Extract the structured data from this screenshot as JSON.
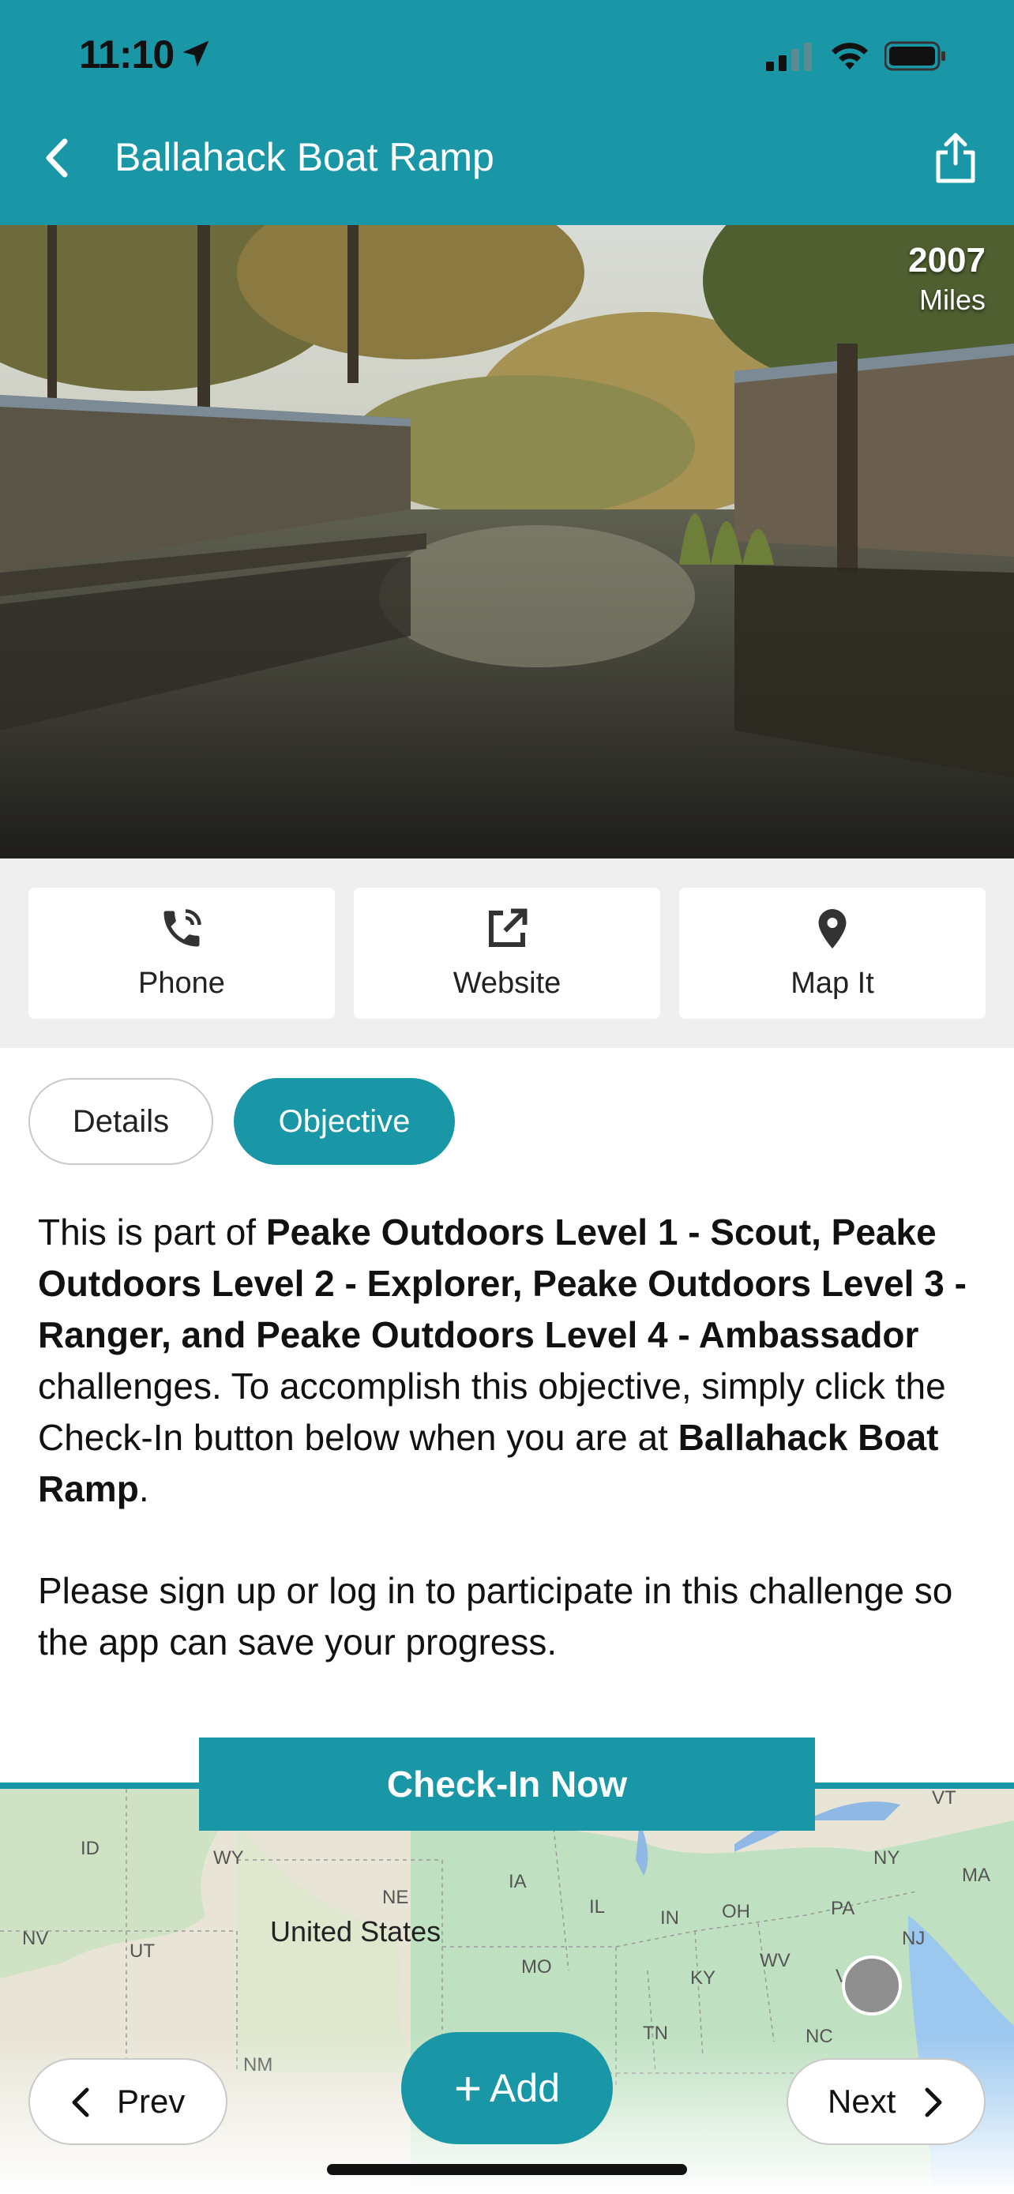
{
  "status": {
    "time": "11:10"
  },
  "header": {
    "title": "Ballahack Boat Ramp"
  },
  "photo": {
    "distance_value": "2007",
    "distance_unit": "Miles"
  },
  "actions": [
    {
      "label": "Phone",
      "icon": "phone-icon"
    },
    {
      "label": "Website",
      "icon": "external-link-icon"
    },
    {
      "label": "Map It",
      "icon": "map-pin-icon"
    }
  ],
  "tabs": {
    "details": "Details",
    "objective": "Objective",
    "active": "Objective"
  },
  "objective": {
    "p1_a": "This is part of ",
    "p1_b": "Peake Outdoors Level 1 - Scout, Peake Outdoors Level 2 - Explorer, Peake Outdoors Level 3 - Ranger, and Peake Outdoors Level 4 - Ambassador",
    "p1_c": " challenges. To accomplish this objective, simply click the Check-In button below when you are at ",
    "p1_d": "Ballahack Boat Ramp",
    "p1_e": ".",
    "p2": "Please sign up or log in to participate in this challenge so the app can save your progress."
  },
  "checkin_label": "Check-In Now",
  "map": {
    "country": "United States",
    "states": [
      "ID",
      "WY",
      "NE",
      "IA",
      "IL",
      "IN",
      "OH",
      "PA",
      "NY",
      "MA",
      "NJ",
      "NV",
      "UT",
      "MO",
      "KY",
      "WV",
      "TN",
      "NC",
      "VT",
      "NM",
      "V"
    ]
  },
  "nav": {
    "prev": "Prev",
    "add": "Add",
    "next": "Next"
  },
  "colors": {
    "accent": "#1a97a6"
  }
}
